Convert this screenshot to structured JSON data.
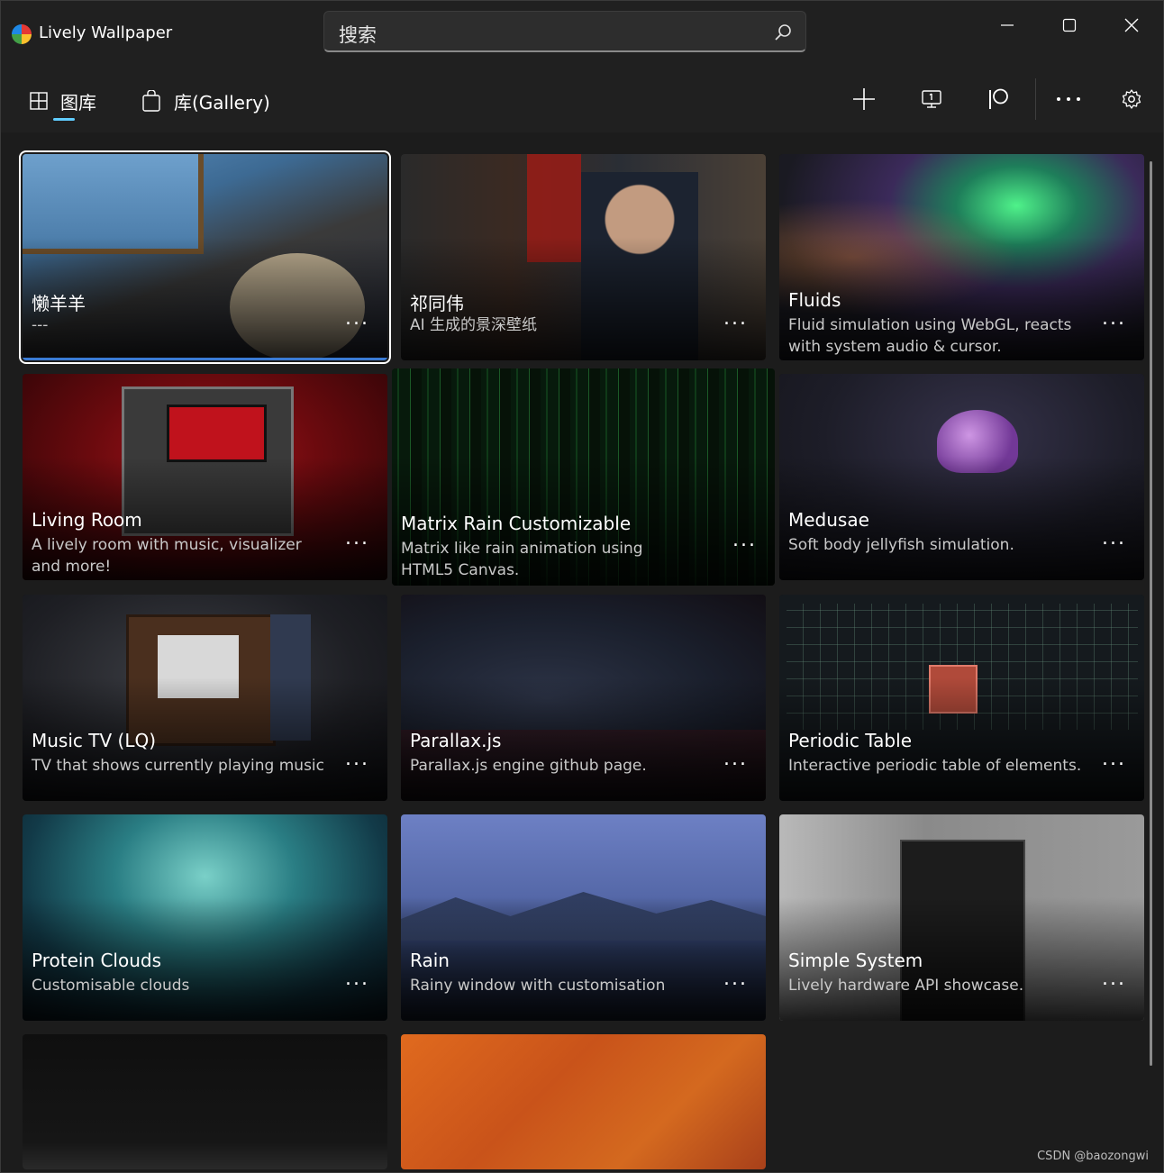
{
  "window": {
    "title": "Lively Wallpaper"
  },
  "search": {
    "placeholder": "搜索"
  },
  "nav": {
    "tabs": [
      {
        "label": "图库"
      },
      {
        "label": "库(Gallery)"
      }
    ]
  },
  "cards": [
    {
      "title": "懒羊羊",
      "desc": "---"
    },
    {
      "title": "祁同伟",
      "desc": "AI 生成的景深壁纸"
    },
    {
      "title": "Fluids",
      "desc": "Fluid simulation using WebGL, reacts with system audio & cursor."
    },
    {
      "title": "Living Room",
      "desc": "A lively room with music, visualizer and more!"
    },
    {
      "title": "Matrix Rain Customizable",
      "desc": "Matrix like rain animation using HTML5 Canvas."
    },
    {
      "title": "Medusae",
      "desc": "Soft body jellyfish simulation."
    },
    {
      "title": "Music TV (LQ)",
      "desc": "TV that shows currently playing music"
    },
    {
      "title": "Parallax.js",
      "desc": "Parallax.js engine github page."
    },
    {
      "title": "Periodic Table",
      "desc": "Interactive periodic table of elements."
    },
    {
      "title": "Protein Clouds",
      "desc": "Customisable clouds"
    },
    {
      "title": "Rain",
      "desc": "Rainy window with customisation"
    },
    {
      "title": "Simple System",
      "desc": "Lively hardware API showcase."
    }
  ],
  "card_more_label": "...",
  "watermark": "CSDN @baozongwi",
  "colors": {
    "accent": "#60cdff",
    "background": "#202020",
    "selection": "#3a7bd5"
  }
}
